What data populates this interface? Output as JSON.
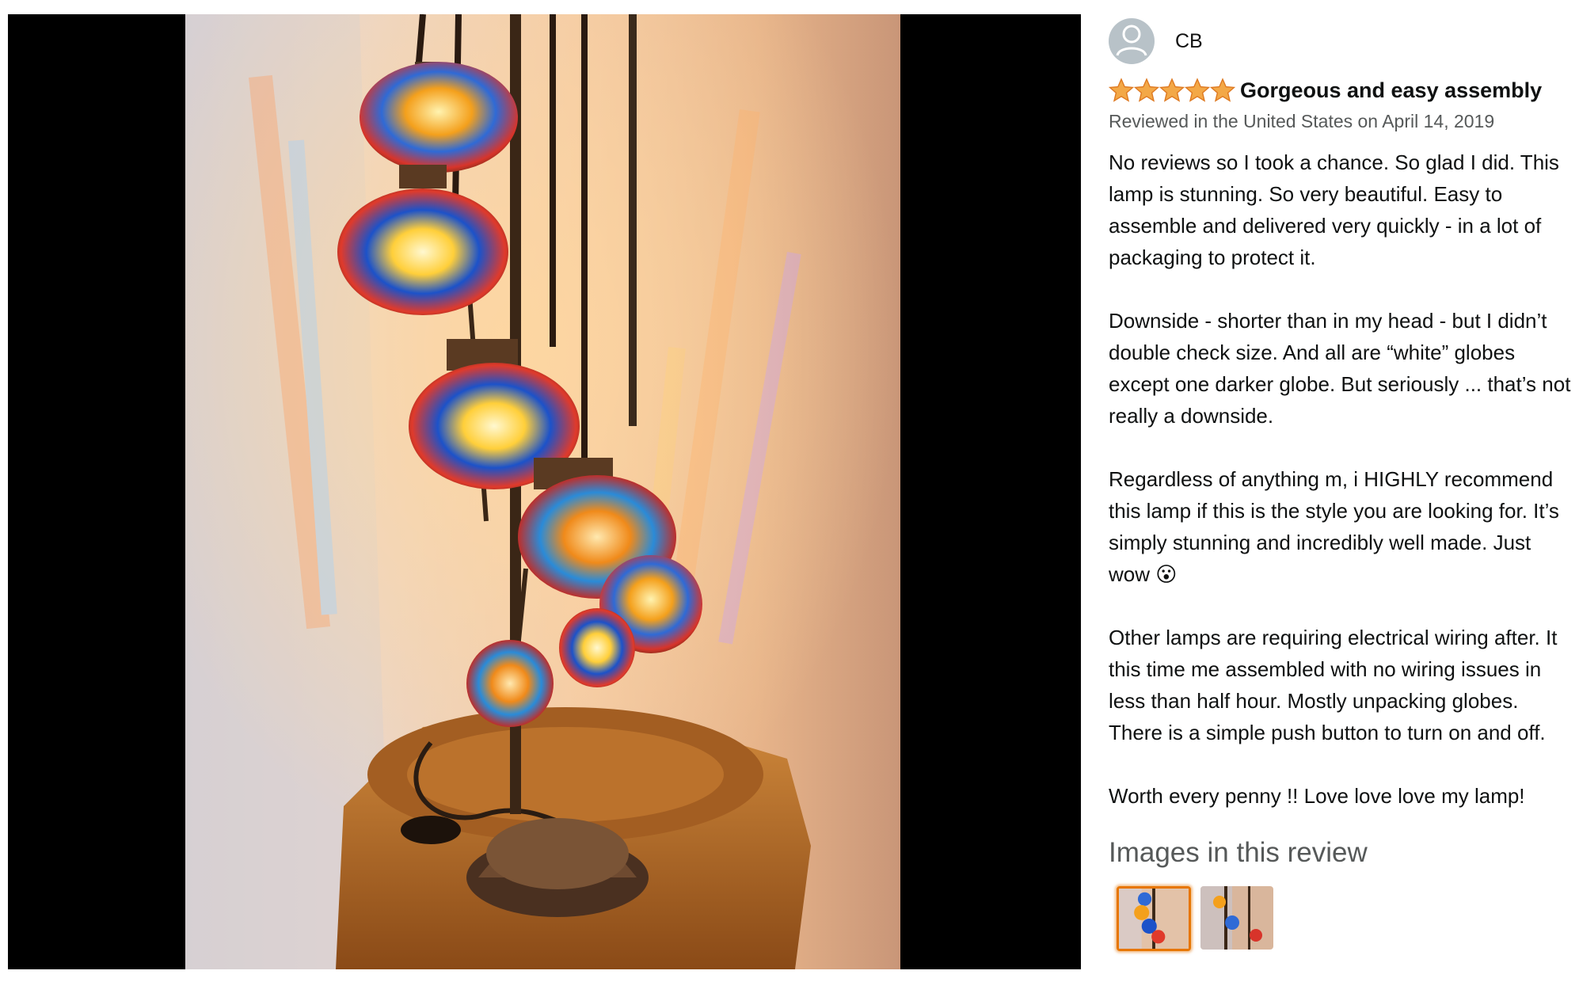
{
  "viewer": {
    "image_alt": "Mosaic floor lamp with multicolored glass globes",
    "colors": {
      "background": "#000000",
      "wall": "#e8cfc0",
      "table": "#b06a24"
    }
  },
  "review": {
    "reviewer_name": "CB",
    "rating": 5,
    "rating_color": "#f3a847",
    "title": "Gorgeous and easy assembly",
    "meta": "Reviewed in the United States on April 14, 2019",
    "paragraphs": [
      "No reviews so I took a chance. So glad I did. This lamp is stunning. So very beautiful. Easy to assemble and delivered very quickly - in a lot of packaging to protect it.",
      "Downside - shorter than in my head - but I didn’t double check size. And all are “white” globes except one darker globe. But seriously ... that’s not really a downside.",
      "Regardless of anything m, i HIGHLY recommend this lamp if this is the style you are looking for. It’s simply stunning and incredibly well made. Just wow 😮",
      "Other lamps are requiring electrical wiring after. It this time me assembled with no wiring issues in less than half hour. Mostly unpacking globes. There is a simple push button to turn on and off.",
      "Worth every penny !! Love love love my lamp!"
    ],
    "images_heading": "Images in this review",
    "thumbnails": [
      {
        "name": "review-image-1",
        "selected": true
      },
      {
        "name": "review-image-2",
        "selected": false
      }
    ],
    "selected_border_color": "#e77600"
  }
}
